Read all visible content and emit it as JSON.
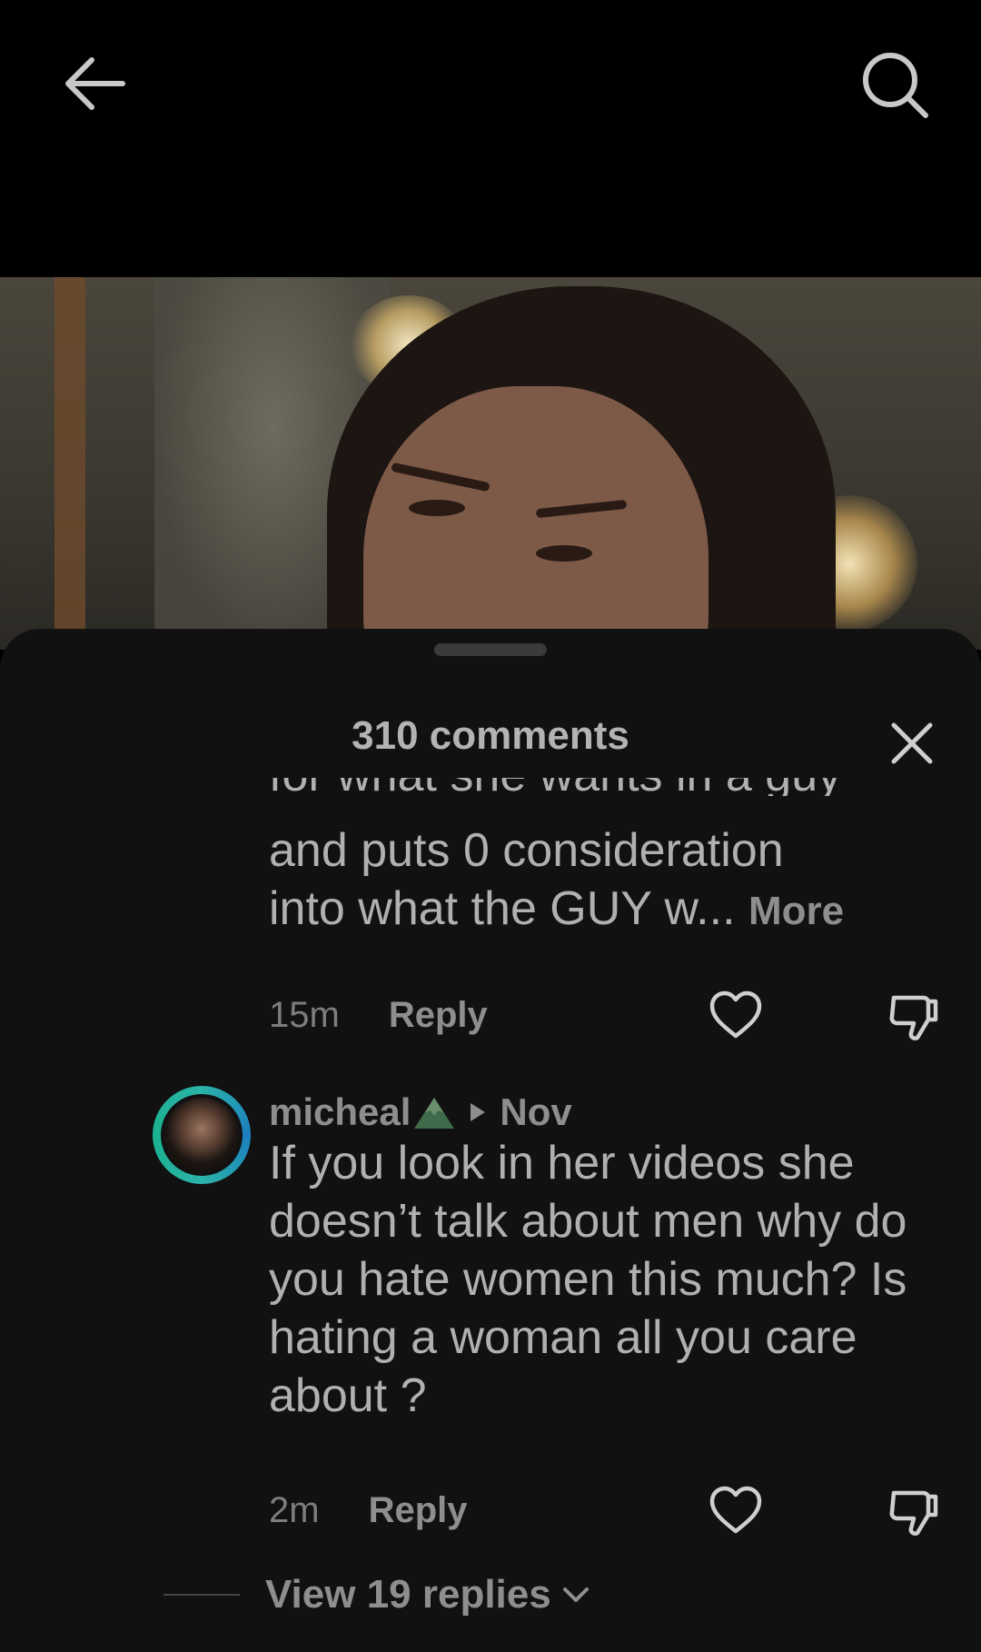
{
  "header": {
    "back_icon": "arrow-left-icon",
    "search_icon": "search-icon"
  },
  "comments_sheet": {
    "title": "310 comments",
    "close_icon": "close-icon",
    "comments": [
      {
        "text_clipped_line": "for what she wants in a guy",
        "text_line_1": "and puts 0 consideration",
        "text_line_2": "into what the GUY w...",
        "more_label": "More",
        "time": "15m",
        "reply_label": "Reply"
      },
      {
        "username": "micheal",
        "badge_icon": "mountain-emoji-icon",
        "separator_icon": "triangle-right-icon",
        "date": "Nov",
        "text": "If you look in her videos she doesn’t talk about men why do you hate women this much? Is hating a woman all you care about ?",
        "time": "2m",
        "reply_label": "Reply"
      }
    ],
    "view_replies_label": "View 19 replies"
  },
  "colors": {
    "background": "#000000",
    "sheet": "#111111",
    "text_primary": "#b0b0b0",
    "text_muted": "#8e8e8e",
    "avatar_ring": "#2ab3a8"
  }
}
